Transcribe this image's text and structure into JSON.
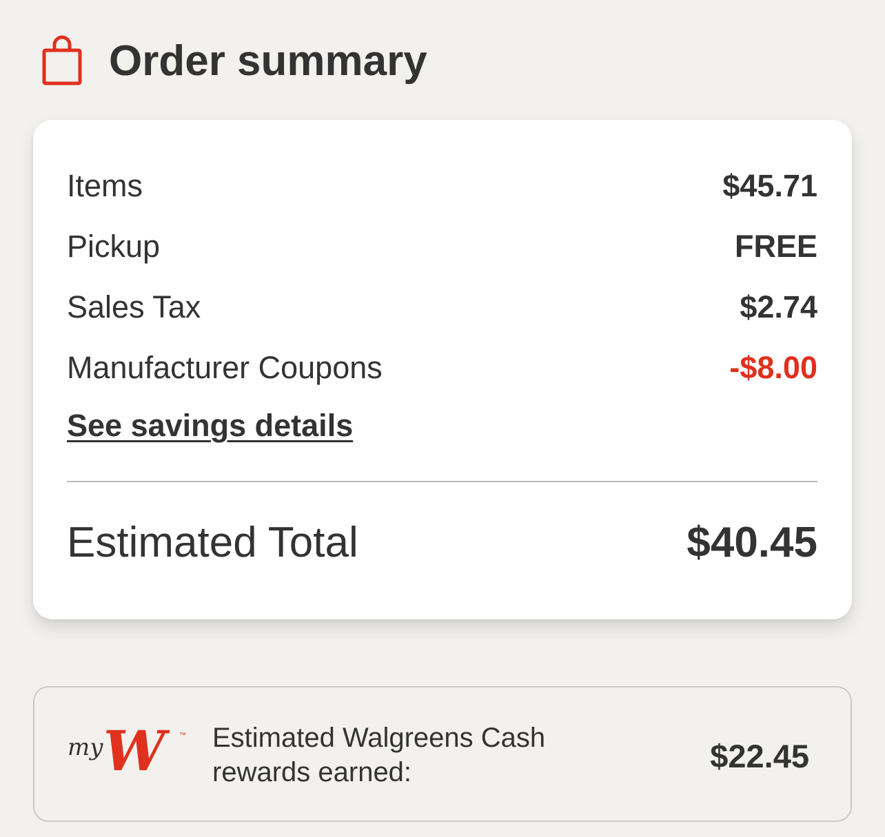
{
  "header": {
    "icon": "shopping-bag-icon",
    "title": "Order summary"
  },
  "summary": {
    "rows": [
      {
        "label": "Items",
        "value": "$45.71"
      },
      {
        "label": "Pickup",
        "value": "FREE"
      },
      {
        "label": "Sales Tax",
        "value": "$2.74"
      },
      {
        "label": "Manufacturer Coupons",
        "value": "-$8.00"
      }
    ],
    "savings_link": "See savings details",
    "total_label": "Estimated Total",
    "total_value": "$40.45"
  },
  "rewards": {
    "logo": "myw-logo",
    "logo_text": "myW",
    "text_line1": "Estimated Walgreens Cash",
    "text_line2": "rewards earned:",
    "value": "$22.45"
  },
  "colors": {
    "accent": "#e0301e",
    "background": "#f2f1ee",
    "text": "#333333"
  }
}
